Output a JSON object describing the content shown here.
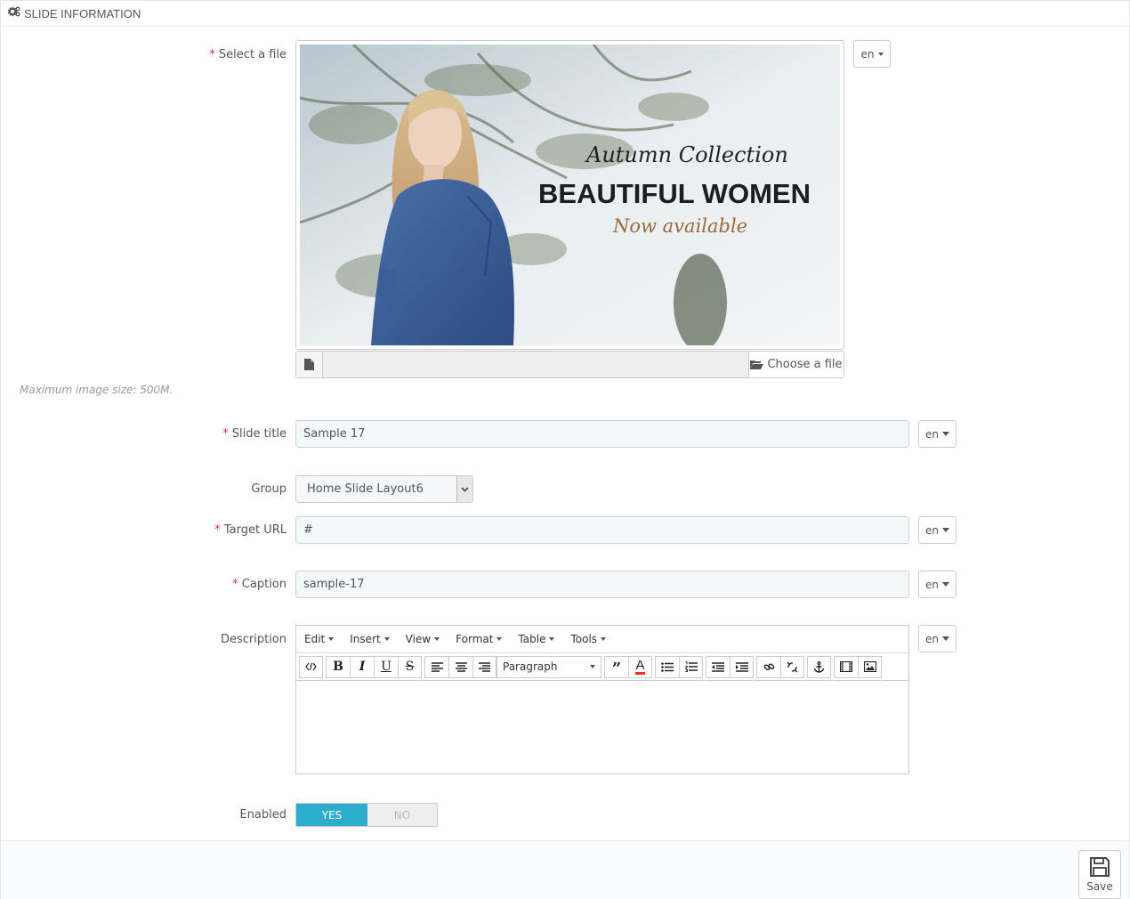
{
  "header": {
    "title": "Slide Information",
    "icon": "gears-icon"
  },
  "fields": {
    "file": {
      "label": "Select a file",
      "lang": "en",
      "choose_label": "Choose a file",
      "hint": "Maximum image size: 500M."
    },
    "slide_image": {
      "line1": "Autumn Collection",
      "line2": "BEAUTIFUL WOMEN",
      "line3": "Now available"
    },
    "slide_title": {
      "label": "Slide title",
      "value": "Sample 17",
      "lang": "en"
    },
    "group": {
      "label": "Group",
      "value": "Home Slide Layout6"
    },
    "target_url": {
      "label": "Target URL",
      "value": "#",
      "lang": "en"
    },
    "caption": {
      "label": "Caption",
      "value": "sample-17",
      "lang": "en"
    },
    "description": {
      "label": "Description",
      "lang": "en",
      "menus": [
        "Edit",
        "Insert",
        "View",
        "Format",
        "Table",
        "Tools"
      ],
      "format_value": "Paragraph"
    },
    "enabled": {
      "label": "Enabled",
      "yes": "YES",
      "no": "NO",
      "value": "yes"
    }
  },
  "footer": {
    "save_label": "Save"
  },
  "colors": {
    "accent": "#2eacce",
    "required": "#e3332c"
  }
}
